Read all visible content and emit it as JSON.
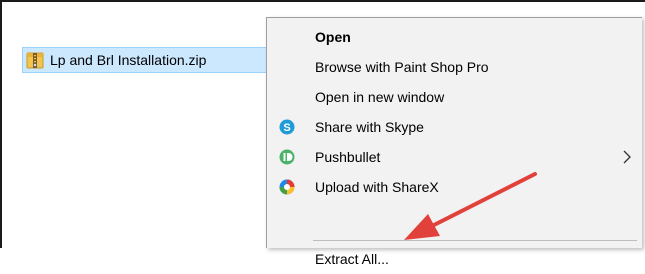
{
  "file": {
    "name": "Lp and Brl Installation.zip",
    "icon": "zip-folder-icon"
  },
  "menu": {
    "items": [
      {
        "label": "Open",
        "bold": true,
        "icon": ""
      },
      {
        "label": "Browse with Paint Shop Pro",
        "icon": ""
      },
      {
        "label": "Open in new window",
        "icon": ""
      },
      {
        "label": "Share with Skype",
        "icon": "skype-icon"
      },
      {
        "label": "Pushbullet",
        "icon": "pushbullet-icon",
        "submenu": true
      },
      {
        "label": "Upload with ShareX",
        "icon": "sharex-icon"
      },
      {
        "label": "Extract All...",
        "icon": ""
      }
    ]
  },
  "colors": {
    "selection_bg": "#cce8ff",
    "menu_bg": "#f2f2f2",
    "arrow": "#e2413b",
    "skype": "#1e9bd7",
    "pushbullet": "#4ab367"
  }
}
